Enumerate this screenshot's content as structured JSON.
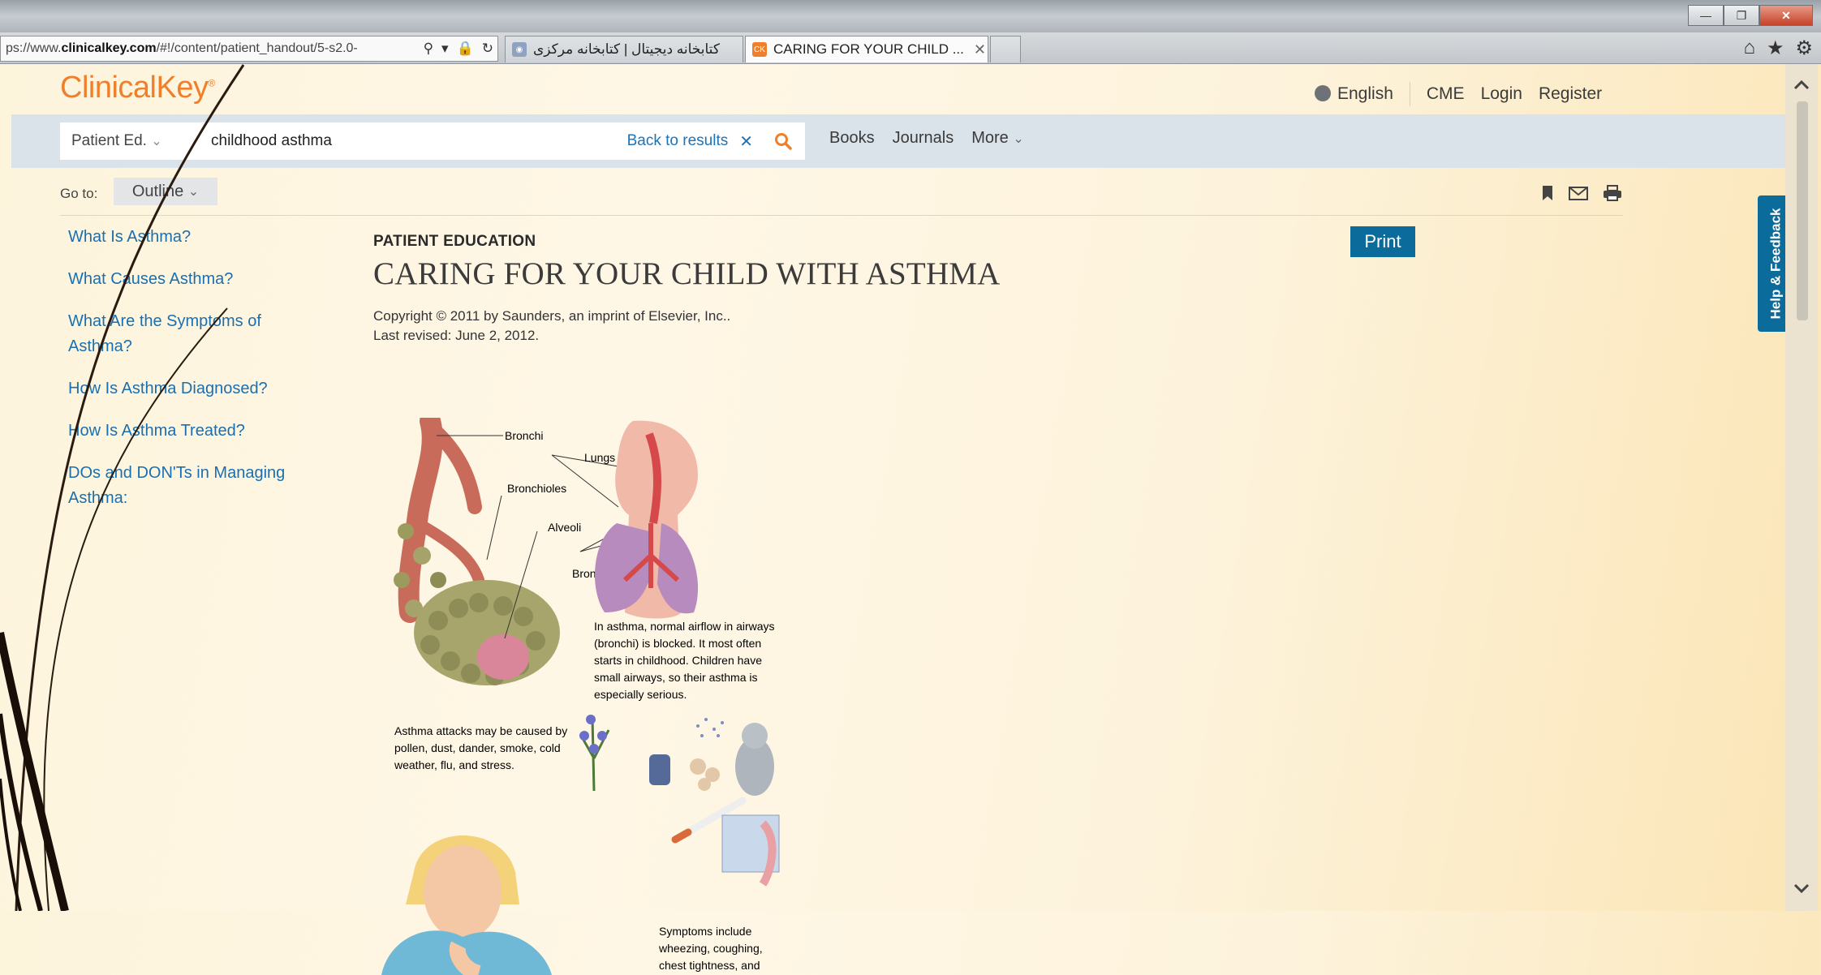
{
  "browser": {
    "url_prefix": "ps://www.",
    "url_domain": "clinicalkey.com",
    "url_path": "/#!/content/patient_handout/5-s2.0-",
    "tabs": [
      {
        "label": "کتابخانه دیجیتال | کتابخانه مرکزی"
      },
      {
        "label": "CARING FOR YOUR CHILD ...",
        "favicon": "CK"
      }
    ]
  },
  "header": {
    "logo": "ClinicalKey",
    "language": "English",
    "links": [
      "CME",
      "Login",
      "Register"
    ]
  },
  "search": {
    "source": "Patient Ed.",
    "query": "childhood asthma",
    "back_label": "Back to results",
    "nav": [
      "Books",
      "Journals",
      "More"
    ]
  },
  "goto": {
    "label": "Go to:",
    "outline": "Outline"
  },
  "toc": [
    "What Is Asthma?",
    "What Causes Asthma?",
    "What Are the Symptoms of Asthma?",
    "How Is Asthma Diagnosed?",
    "How Is Asthma Treated?",
    "DOs and DON'Ts in Managing Asthma:"
  ],
  "article": {
    "kicker": "PATIENT EDUCATION",
    "title": "CARING FOR YOUR CHILD WITH ASTHMA",
    "copyright": "Copyright © 2011 by Saunders, an imprint of Elsevier, Inc..",
    "revised": "Last revised: June 2, 2012.",
    "print": "Print"
  },
  "figure": {
    "labels": {
      "bronchi1": "Bronchi",
      "lungs": "Lungs",
      "bronchioles": "Bronchioles",
      "alveoli": "Alveoli",
      "bronchi2": "Bronchi"
    },
    "cap1": [
      "In asthma, normal airflow in airways",
      "(bronchi) is blocked. It most often",
      "starts in childhood. Children have",
      "small airways, so their asthma is",
      "especially serious."
    ],
    "cap2": [
      "Asthma attacks may be caused by",
      "pollen, dust, dander, smoke, cold",
      "weather, flu, and stress."
    ],
    "cap3": [
      "Symptoms include",
      "wheezing, coughing,",
      "chest tightness, and"
    ]
  },
  "feedback": "Help & Feedback",
  "colors": {
    "accent": "#f07f2b",
    "link": "#1a6fb0",
    "button": "#0b6b9a"
  }
}
